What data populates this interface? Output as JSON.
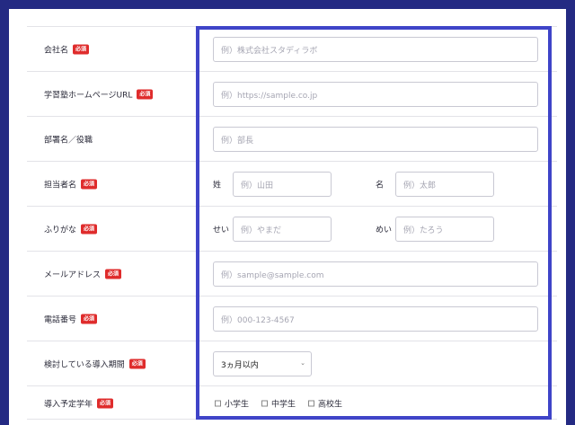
{
  "required_badge": "必須",
  "fields": {
    "company": {
      "label": "会社名",
      "placeholder": "例）株式会社スタディラボ"
    },
    "url": {
      "label": "学習塾ホームページURL",
      "placeholder": "例）https://sample.co.jp"
    },
    "dept": {
      "label": "部署名／役職",
      "placeholder": "例）部長"
    },
    "name": {
      "label": "担当者名",
      "last_label": "姓",
      "last_placeholder": "例）山田",
      "first_label": "名",
      "first_placeholder": "例）太郎"
    },
    "kana": {
      "label": "ふりがな",
      "last_label": "せい",
      "last_placeholder": "例）やまだ",
      "first_label": "めい",
      "first_placeholder": "例）たろう"
    },
    "email": {
      "label": "メールアドレス",
      "placeholder": "例）sample@sample.com"
    },
    "phone": {
      "label": "電話番号",
      "placeholder": "例）000-123-4567"
    },
    "period": {
      "label": "検討している導入期間",
      "value": "3ヵ月以内"
    },
    "grade": {
      "label": "導入予定学年",
      "options": [
        "小学生",
        "中学生",
        "高校生"
      ]
    }
  },
  "colors": {
    "background": "#242a83",
    "frame": "#3f44c8",
    "badge": "#df2c2c"
  }
}
